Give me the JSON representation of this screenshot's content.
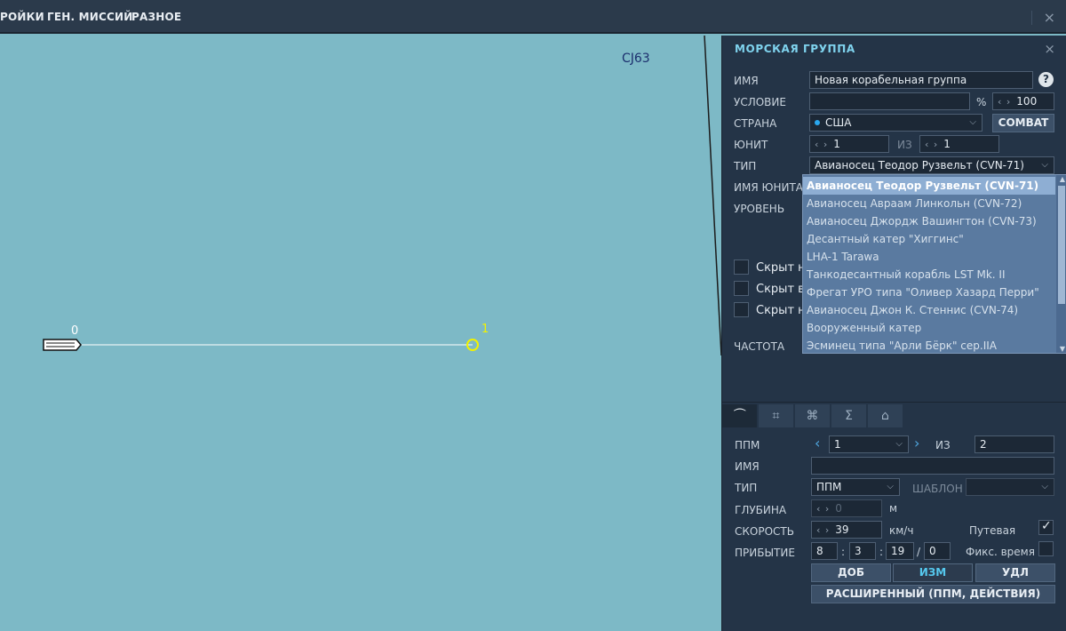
{
  "topbar": {
    "menu": [
      "РОЙКИ",
      "ГЕН. МИССИЙ",
      "РАЗНОЕ"
    ],
    "close": "×"
  },
  "map": {
    "grid_label": "CJ63",
    "waypoint_labels": [
      "0",
      "1"
    ],
    "colors": {
      "water": "#7db9c6",
      "route": "#ffffff",
      "active_waypoint": "#f2f200"
    }
  },
  "panel": {
    "title": "МОРСКАЯ ГРУППА",
    "close": "×",
    "labels": {
      "name": "ИМЯ",
      "condition": "УСЛОВИЕ",
      "country": "СТРАНА",
      "unit": "ЮНИТ",
      "type": "ТИП",
      "unit_name": "ИМЯ ЮНИТА",
      "level": "УРОВЕНЬ",
      "frequency": "ЧАСТОТА",
      "of": "ИЗ",
      "percent": "%"
    },
    "name_value": "Новая корабельная группа",
    "help": "?",
    "condition_value": "",
    "percent_value": "100",
    "country_value": "США",
    "combat_button": "COMBAT",
    "unit_value": "1",
    "unit_of_value": "1",
    "type_value": "Авианосец Теодор Рузвельт (CVN-71)",
    "checkboxes": [
      "Скрыт на",
      "Скрыт в",
      "Скрыт на"
    ],
    "type_options": [
      "Авианосец Теодор Рузвельт (CVN-71)",
      "Авианосец Авраам Линкольн (CVN-72)",
      "Авианосец Джордж Вашингтон (CVN-73)",
      "Десантный катер \"Хиггинс\"",
      "LHA-1 Tarawa",
      "Танкодесантный корабль LST Mk. II",
      "Фрегат УРО типа \"Оливер Хазард Перри\"",
      "Авианосец Джон К. Стеннис (CVN-74)",
      "Вооруженный катер",
      "Эсминец типа \"Арли Бёрк\" сер.IIA"
    ],
    "tabs": [
      "route-icon",
      "target-icon",
      "network-icon",
      "sigma-icon",
      "hangar-icon"
    ],
    "waypoint": {
      "labels": {
        "ppm": "ППМ",
        "of": "ИЗ",
        "name": "ИМЯ",
        "type": "ТИП",
        "template": "ШАБЛОН",
        "depth": "ГЛУБИНА",
        "depth_unit": "м",
        "speed": "СКОРОСТЬ",
        "speed_unit": "км/ч",
        "route": "Путевая",
        "arrival": "ПРИБЫТИЕ",
        "fixed_time": "Фикс. время"
      },
      "current": "1",
      "total": "2",
      "name_value": "",
      "type_value": "ППМ",
      "template_value": "",
      "depth_value": "0",
      "speed_value": "39",
      "route_checked": true,
      "fixed_time_checked": false,
      "arrival": {
        "days": "8",
        "hours": "3",
        "minutes": "19",
        "seconds": "0"
      },
      "buttons": {
        "add": "ДОБ",
        "edit": "ИЗМ",
        "delete": "УДЛ",
        "advanced": "РАСШИРЕННЫЙ (ППМ, ДЕЙСТВИЯ)"
      }
    }
  }
}
